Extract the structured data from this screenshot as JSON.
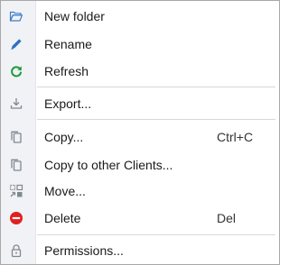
{
  "menu": {
    "items": [
      {
        "label": "New folder",
        "icon": "folder-open-icon"
      },
      {
        "label": "Rename",
        "icon": "pencil-icon"
      },
      {
        "label": "Refresh",
        "icon": "refresh-icon"
      },
      {
        "label": "Export...",
        "icon": "export-download-icon"
      },
      {
        "label": "Copy...",
        "icon": "copy-icon",
        "shortcut": "Ctrl+C"
      },
      {
        "label": "Copy to other Clients...",
        "icon": "copy-to-clients-icon"
      },
      {
        "label": "Move...",
        "icon": "move-icon"
      },
      {
        "label": "Delete",
        "icon": "delete-icon",
        "shortcut": "Del"
      },
      {
        "label": "Permissions...",
        "icon": "lock-icon"
      }
    ]
  },
  "colors": {
    "folder_blue": "#3d7cc9",
    "pencil_blue": "#2f6fc4",
    "refresh_green": "#1e9a3a",
    "delete_red": "#e02020",
    "icon_gray": "#808890"
  }
}
